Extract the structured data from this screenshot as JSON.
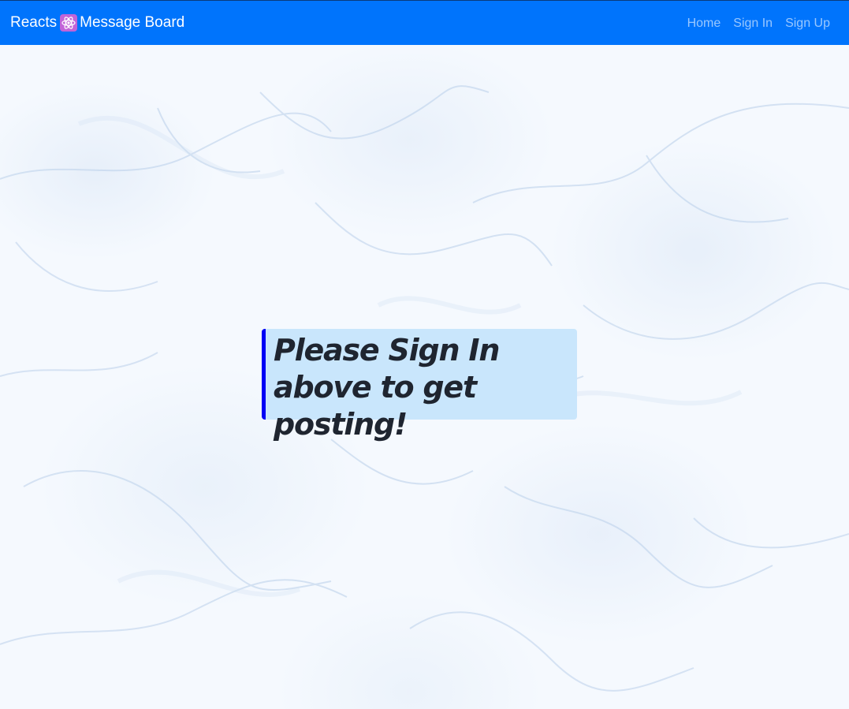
{
  "navbar": {
    "brand_prefix": "Reacts",
    "brand_icon": "atom-icon",
    "brand_suffix": "Message Board",
    "links": [
      {
        "label": "Home"
      },
      {
        "label": "Sign In"
      },
      {
        "label": "Sign Up"
      }
    ],
    "background_color": "#0074fc"
  },
  "main": {
    "notice_text": "Please Sign In above to get posting!",
    "notice_background": "#c9e6fc",
    "notice_accent": "#0000f5"
  }
}
